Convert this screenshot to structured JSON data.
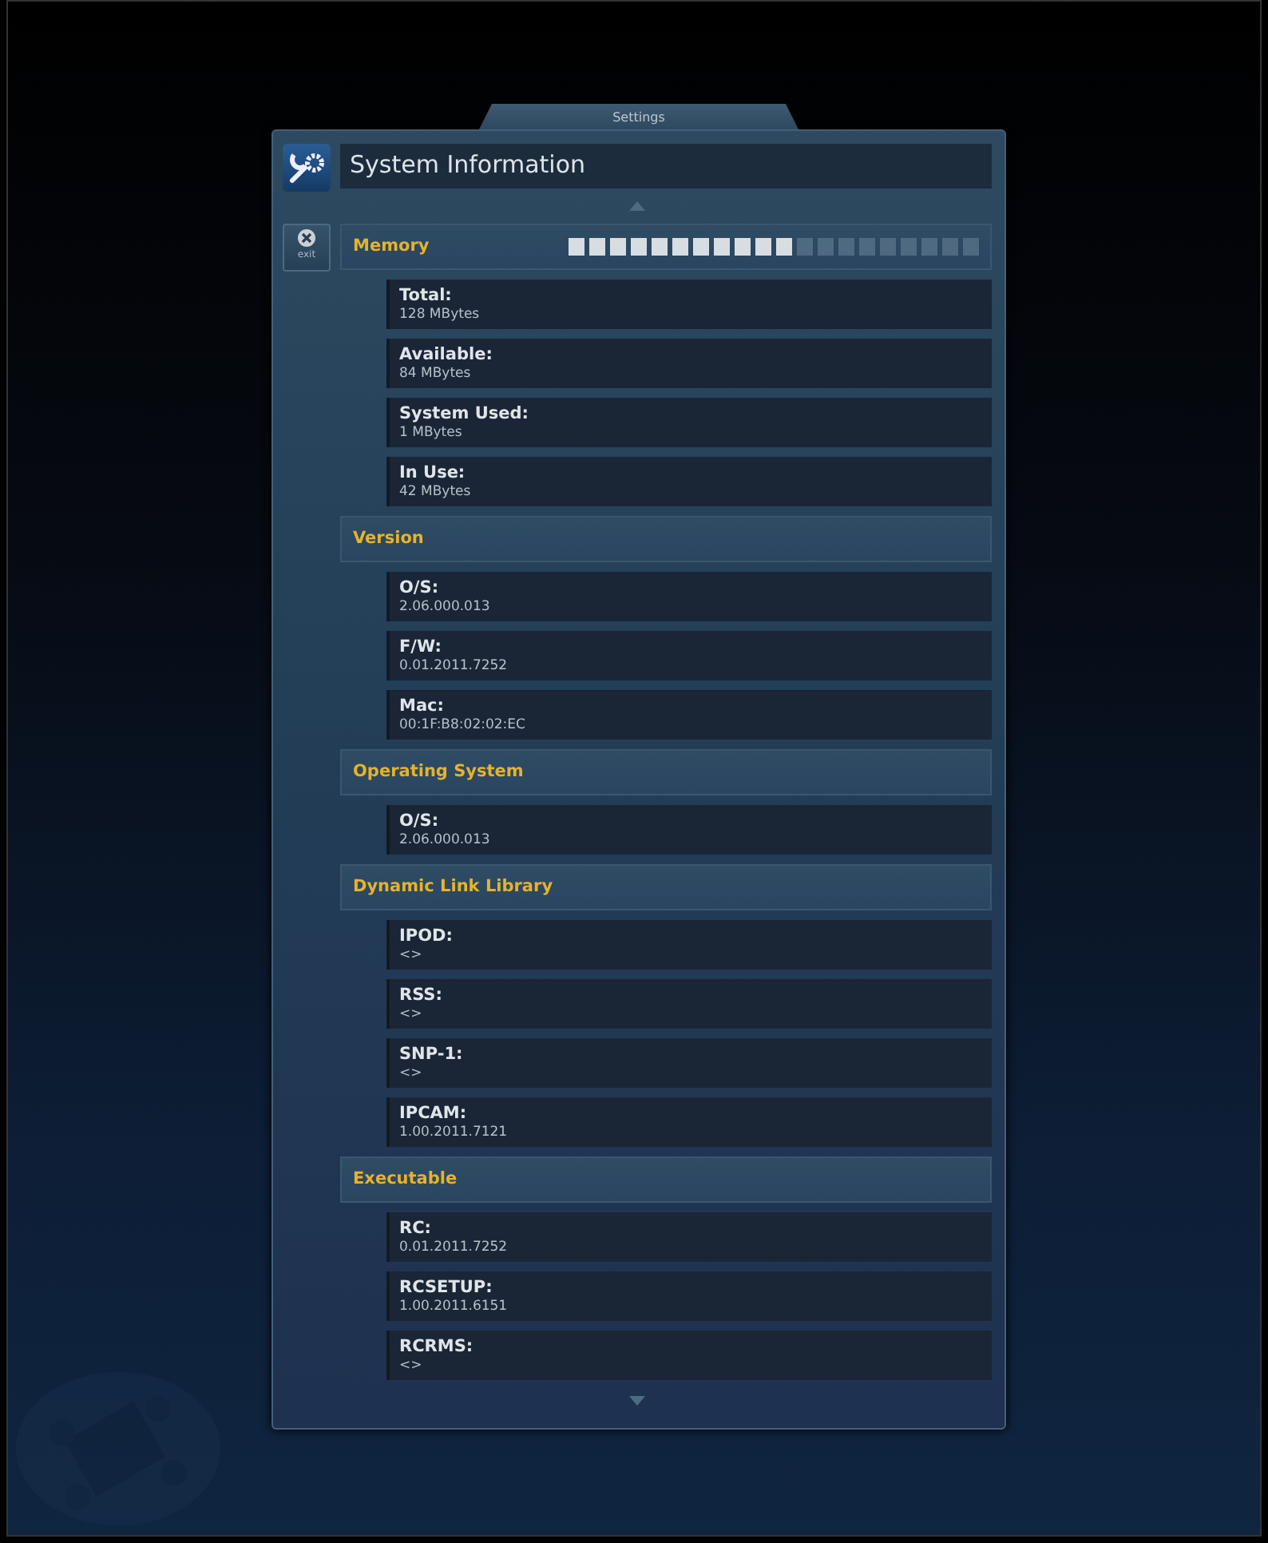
{
  "window": {
    "tab_title": "Settings",
    "title": "System Information"
  },
  "exit_button": {
    "label": "exit"
  },
  "sections": [
    {
      "title": "Memory",
      "meter": {
        "level": 0.55
      },
      "items": [
        {
          "label": "Total:",
          "value": "128 MBytes"
        },
        {
          "label": "Available:",
          "value": "84 MBytes"
        },
        {
          "label": "System Used:",
          "value": "1 MBytes"
        },
        {
          "label": "In Use:",
          "value": "42 MBytes"
        }
      ]
    },
    {
      "title": "Version",
      "items": [
        {
          "label": "O/S:",
          "value": "2.06.000.013"
        },
        {
          "label": "F/W:",
          "value": "0.01.2011.7252"
        },
        {
          "label": "Mac:",
          "value": "00:1F:B8:02:02:EC"
        }
      ]
    },
    {
      "title": "Operating System",
      "items": [
        {
          "label": "O/S:",
          "value": "2.06.000.013"
        }
      ]
    },
    {
      "title": "Dynamic Link Library",
      "items": [
        {
          "label": "IPOD:",
          "value": "<>"
        },
        {
          "label": "RSS:",
          "value": "<>"
        },
        {
          "label": "SNP-1:",
          "value": "<>"
        },
        {
          "label": "IPCAM:",
          "value": "1.00.2011.7121"
        }
      ]
    },
    {
      "title": "Executable",
      "items": [
        {
          "label": "RC:",
          "value": "0.01.2011.7252"
        },
        {
          "label": "RCSETUP:",
          "value": "1.00.2011.6151"
        },
        {
          "label": "RCRMS:",
          "value": "<>"
        }
      ]
    }
  ]
}
